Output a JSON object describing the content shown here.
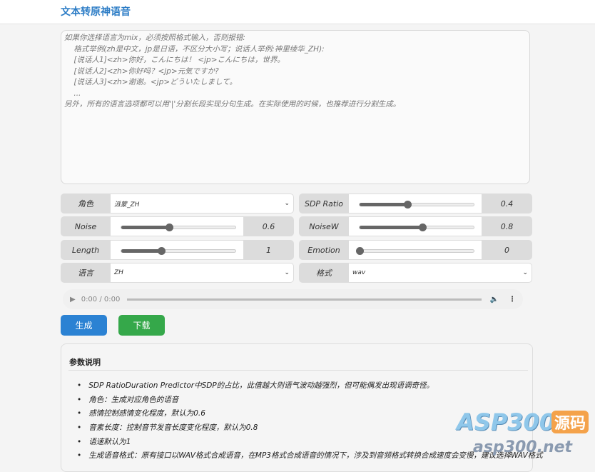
{
  "header": {
    "title": "文本转原神语音"
  },
  "input": {
    "placeholder_lines": [
      "如果你选择语言为mix，必须按照格式输入，否则报错:",
      "    格式举例(zh是中文，jp是日语，不区分大小写；说话人举例:神里绫华_ZH):",
      "    [说话人1]<zh>你好，こんにちは！ <jp>こんにちは，世界。",
      "    [说话人2]<zh>你好吗？<jp>元気ですか?",
      "    [说话人3]<zh>谢谢。<jp>どういたしまして。",
      "    ...",
      "另外，所有的语言选项都可以用'|'分割长段实现分句生成。在实际使用的时候，也推荐进行分割生成。"
    ]
  },
  "controls": {
    "speaker": {
      "label": "角色",
      "value": "派蒙_ZH"
    },
    "sdp_ratio": {
      "label": "SDP Ratio",
      "value": "0.4",
      "fill": 0.42
    },
    "noise": {
      "label": "Noise",
      "value": "0.6",
      "fill": 0.42
    },
    "noisew": {
      "label": "NoiseW",
      "value": "0.8",
      "fill": 0.55
    },
    "length": {
      "label": "Length",
      "value": "1",
      "fill": 0.35
    },
    "emotion": {
      "label": "Emotion",
      "value": "0",
      "fill": 0
    },
    "language": {
      "label": "语言",
      "value": "ZH"
    },
    "format": {
      "label": "格式",
      "value": "wav"
    }
  },
  "audio": {
    "time": "0:00 / 0:00"
  },
  "buttons": {
    "generate": "生成",
    "download": "下载"
  },
  "colors": {
    "generate": "#2b82d3",
    "download": "#35a84a",
    "title": "#2d7dc6"
  },
  "panel": {
    "title": "参数说明",
    "items": [
      "SDP RatioDuration Predictor中SDP的占比，此值越大则语气波动越强烈，但可能偶发出现语调奇怪。",
      "角色：生成对应角色的语音",
      "感情控制感情变化程度，默认为0.6",
      "音素长度：控制音节发音长度变化程度，默认为0.8",
      "语速默认为1",
      "生成语音格式：原有接口以WAV格式合成语音，在MP3格式合成语音的情况下，涉及到音频格式转换合成速度会变慢，建议选择WAV格式"
    ]
  },
  "watermark": {
    "brand": "ASP300",
    "tag": "源码",
    "url": "asp300.net"
  }
}
